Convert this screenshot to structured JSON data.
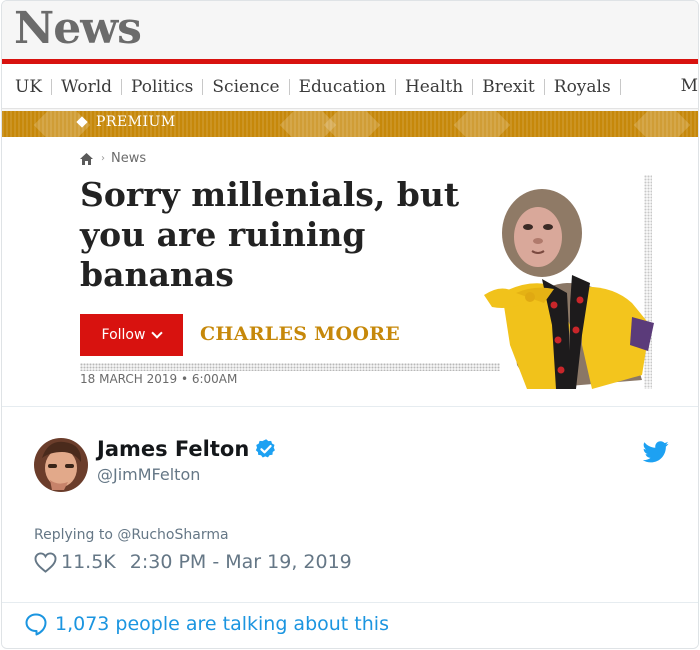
{
  "newspaper": {
    "logo": "News",
    "nav": [
      "UK",
      "World",
      "Politics",
      "Science",
      "Education",
      "Health",
      "Brexit",
      "Royals"
    ],
    "nav_more": "M",
    "premium_label": "PREMIUM",
    "breadcrumb": "News",
    "headline": "Sorry millenials, but you are ruining bananas",
    "follow_label": "Follow",
    "author": "CHARLES MOORE",
    "dateline": "18 MARCH 2019 • 6:00AM",
    "photo_icon": "monkey-in-costume-photo",
    "colors": {
      "brand_red": "#d8120f",
      "gold": "#c6880a"
    }
  },
  "tweet": {
    "name": "James Felton",
    "handle": "@JimMFelton",
    "reply_line": "Replying to @RuchoSharma",
    "likes": "11.5K",
    "timestamp": "2:30 PM - Mar 19, 2019",
    "talking": "1,073 people are talking about this",
    "colors": {
      "link_blue": "#1b95e0",
      "muted": "#657786"
    }
  }
}
